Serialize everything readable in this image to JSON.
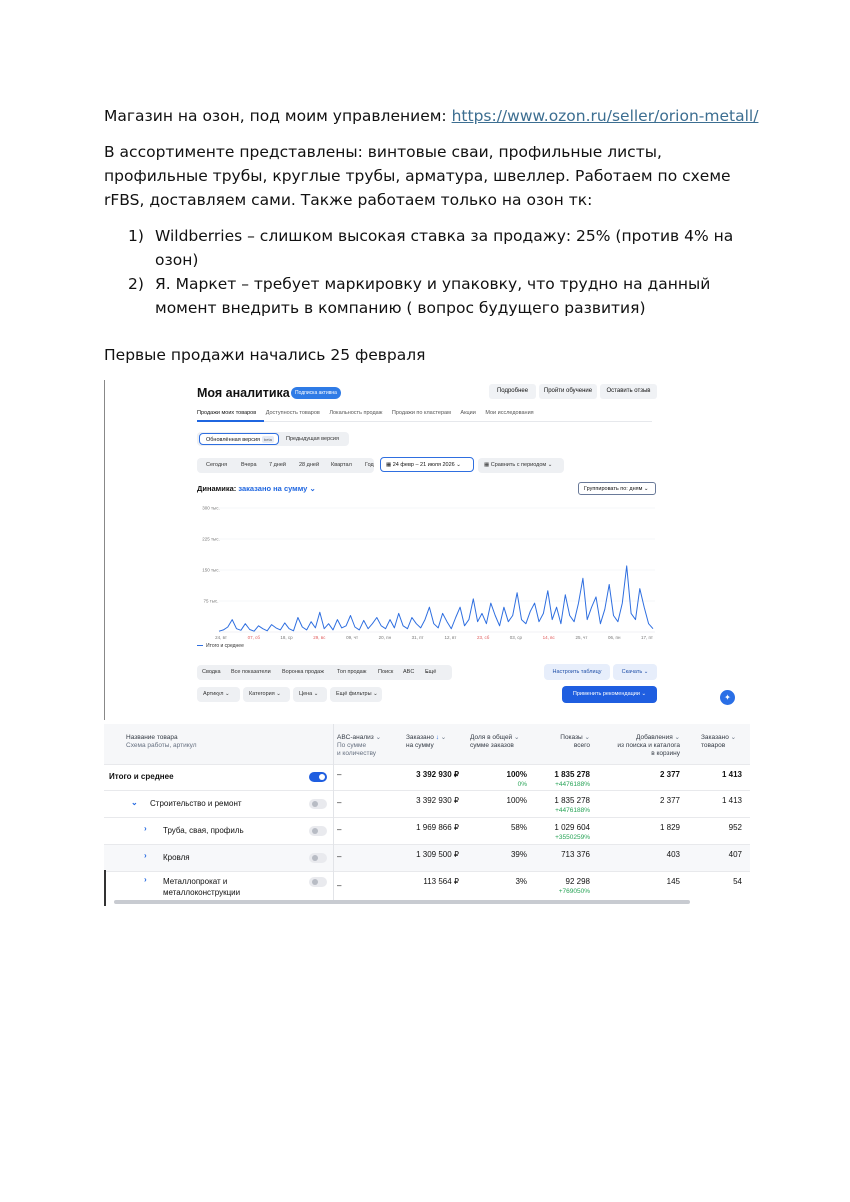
{
  "doc": {
    "intro_text": "Магазин на озон, под моим управлением: ",
    "intro_link": "https://www.ozon.ru/seller/orion-metall/",
    "assortment": "В ассортименте представлены: винтовые сваи, профильные листы, профильные трубы, круглые трубы, арматура, швеллер. Работаем по схеме rFBS, доставляем сами. Также работаем только на озон тк:",
    "list": [
      {
        "num": "1)",
        "text": "Wildberries – слишком высокая ставка за продажу: 25% (против 4% на озон)"
      },
      {
        "num": "2)",
        "text": "Я. Маркет – требует маркировку и упаковку, что трудно на данный момент внедрить в компанию ( вопрос будущего развития)"
      }
    ],
    "first_sales": "Первые продажи начались 25 февраля"
  },
  "analytics": {
    "title": "Моя аналитика",
    "badge": "Подписка активна",
    "header_buttons": [
      "Подробнее",
      "Пройти обучение",
      "Оставить отзыв"
    ],
    "tabs": [
      "Продажи моих товаров",
      "Доступность товаров",
      "Локальность продаж",
      "Продажи по кластерам",
      "Акции",
      "Мои исследования"
    ],
    "version_new": "Обновлённая версия",
    "version_beta": "beta",
    "version_prev": "Предыдущая версия",
    "periods": [
      "Сегодня",
      "Вчера",
      "7 дней",
      "28 дней",
      "Квартал",
      "Год"
    ],
    "date_range": "24 февр – 21 июля 2026",
    "compare": "Сравнить с периодом",
    "dynamics_label": "Динамика:",
    "dynamics_value": "заказано на сумму",
    "group_by": "Группировать по: дням",
    "legend": "Итого и среднее",
    "table_tabs": [
      "Сводка",
      "Все показатели",
      "Воронка продаж",
      "Топ продаж",
      "Поиск",
      "ABC",
      "Ещё"
    ],
    "setup_table": "Настроить таблицу",
    "download": "Скачать",
    "filters": [
      "Артикул",
      "Категория",
      "Цена",
      "Ещё фильтры"
    ],
    "apply_recs": "Применить рекомендации",
    "columns": {
      "name": "Название товара",
      "name_sub": "Схема работы, артикул",
      "abc": "ABC-анализ",
      "abc_sub1": "По сумме",
      "abc_sub2": "и количеству",
      "ordered": "Заказано",
      "ordered_sub": "на сумму",
      "share": "Доля в общей",
      "share_sub": "сумме заказов",
      "views": "Показы",
      "views_sub": "всего",
      "cart": "Добавления",
      "cart_sub1": "из поиска и каталога",
      "cart_sub2": "в корзину",
      "orders": "Заказано",
      "orders_sub": "товаров"
    },
    "rows": [
      {
        "name": "Итого и среднее",
        "abc": "–",
        "sum": "3 392 930 ₽",
        "share": "100%",
        "share_sub": "0%",
        "views": "1 835 278",
        "views_sub": "+4476188%",
        "cart": "2 377",
        "qty": "1 413"
      },
      {
        "name": "Строительство и ремонт",
        "abc": "–",
        "sum": "3 392 930 ₽",
        "share": "100%",
        "views": "1 835 278",
        "views_sub": "+4476188%",
        "cart": "2 377",
        "qty": "1 413"
      },
      {
        "name": "Труба, свая, профиль",
        "abc": "–",
        "sum": "1 969 866 ₽",
        "share": "58%",
        "views": "1 029 604",
        "views_sub": "+3550259%",
        "cart": "1 829",
        "qty": "952"
      },
      {
        "name": "Кровля",
        "abc": "–",
        "sum": "1 309 500 ₽",
        "share": "39%",
        "views": "713 376",
        "cart": "403",
        "qty": "407"
      },
      {
        "name": "Металлопрокат и",
        "name2": "металлоконструкции",
        "abc": "–",
        "sum": "113 564 ₽",
        "share": "3%",
        "views": "92 298",
        "views_sub": "+769050%",
        "cart": "145",
        "qty": "54"
      }
    ]
  },
  "chart_data": {
    "type": "line",
    "series": [
      {
        "name": "Итого и среднее",
        "values": [
          2,
          5,
          12,
          30,
          8,
          4,
          20,
          6,
          2,
          15,
          8,
          3,
          18,
          10,
          5,
          22,
          8,
          3,
          35,
          12,
          5,
          25,
          10,
          48,
          8,
          20,
          5,
          30,
          10,
          15,
          40,
          12,
          5,
          28,
          8,
          20,
          35,
          15,
          8,
          30,
          10,
          45,
          15,
          8,
          35,
          20,
          10,
          30,
          60,
          20,
          10,
          45,
          25,
          8,
          35,
          60,
          15,
          30,
          80,
          25,
          45,
          20,
          70,
          40,
          15,
          60,
          25,
          40,
          95,
          30,
          20,
          50,
          70,
          25,
          45,
          100,
          30,
          60,
          20,
          90,
          40,
          25,
          70,
          130,
          30,
          60,
          85,
          20,
          55,
          115,
          40,
          25,
          70,
          160,
          45,
          30,
          105,
          60,
          20,
          8
        ]
      }
    ],
    "y_ticks": [
      "300 тыс.",
      "225 тыс.",
      "150 тыс.",
      "75 тыс."
    ],
    "x_ticks": [
      "24, вт",
      "07, сб",
      "18, ср",
      "29, вс",
      "09, чт",
      "20, пн",
      "31, пт",
      "12, вт",
      "23, сб",
      "03, ср",
      "14, вс",
      "25, чт",
      "06, пн",
      "17, пт"
    ],
    "weekend_ticks": [
      1,
      3,
      8,
      10
    ],
    "ylim": [
      0,
      300
    ],
    "line_color": "#2f6fe0",
    "weekend_color": "#e05b5b"
  }
}
